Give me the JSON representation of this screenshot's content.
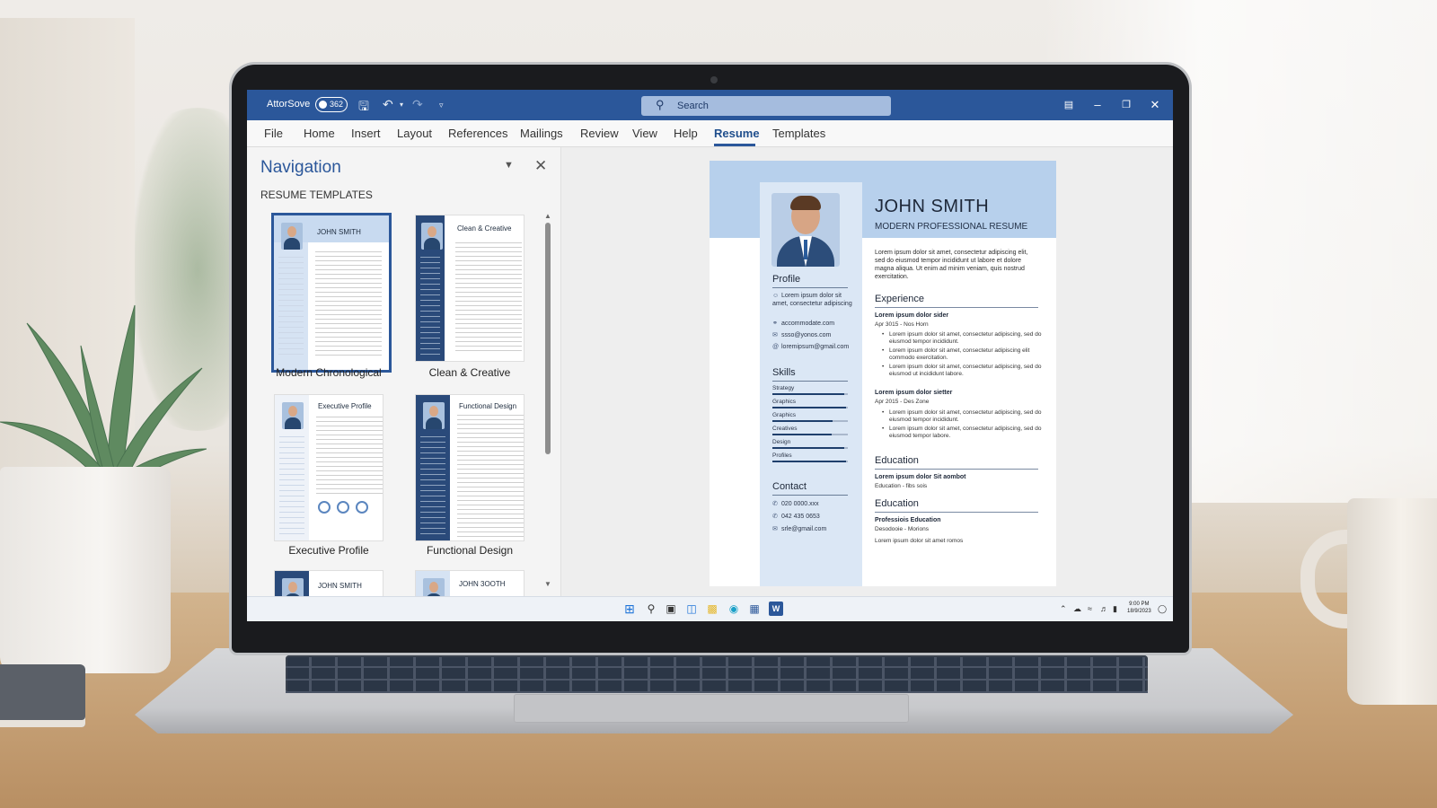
{
  "titlebar": {
    "autosave_label": "AttorSove",
    "autosave_state": "362",
    "search_placeholder": "Search",
    "icons": [
      "save-icon",
      "undo-icon",
      "redo-icon",
      "customize-icon",
      "ribbon-display-icon",
      "minimize-icon",
      "restore-icon",
      "close-icon"
    ],
    "accent_color": "#2b579a"
  },
  "ribbon": {
    "tabs": [
      "File",
      "Home",
      "Insert",
      "Layout",
      "References",
      "Mailings",
      "Review",
      "View",
      "Help",
      "Resume",
      "Templates"
    ],
    "active_tab": "Resume"
  },
  "navigation": {
    "title": "Navigation",
    "section_label": "RESUME TEMPLATES",
    "templates": [
      {
        "label": "Modern Chronological",
        "card_title": "JOHN SMITH",
        "selected": true
      },
      {
        "label": "Clean & Creative",
        "card_title": "Clean & Creative",
        "selected": false
      },
      {
        "label": "Executive Profile",
        "card_title": "Executive Profile",
        "selected": false
      },
      {
        "label": "Functional Design",
        "card_title": "Functional Design",
        "selected": false
      },
      {
        "label": "",
        "card_title": "JOHN SMITH",
        "selected": false
      },
      {
        "label": "",
        "card_title": "JOHN 3OOTH",
        "selected": false
      }
    ]
  },
  "resume": {
    "name": "JOHN SMITH",
    "subtitle": "MODERN PROFESSIONAL RESUME",
    "summary": "Lorem ipsum dolor sit amet, consectetur adipiscing elit, sed do eiusmod tempor incididunt ut labore et dolore magna aliqua. Ut enim ad minim veniam, quis nostrud exercitation.",
    "profile": {
      "heading": "Profile",
      "items": [
        "Lorem ipsum dolor sit amet, consectetur adipiscing",
        "accommodate.com",
        "ssso@yonos.com",
        "loremipsum@gmail.com"
      ]
    },
    "skills": {
      "heading": "Skills",
      "items": [
        {
          "label": "Strategy",
          "level": 0.95
        },
        {
          "label": "Graphics",
          "level": 0.98
        },
        {
          "label": "Graphics",
          "level": 0.8
        },
        {
          "label": "Creatives",
          "level": 0.78
        },
        {
          "label": "Design",
          "level": 0.95
        },
        {
          "label": "Profiles",
          "level": 0.98
        }
      ]
    },
    "contact": {
      "heading": "Contact",
      "items": [
        "020 0000.xxx",
        "042 435 0653",
        "srle@gmail.com"
      ]
    },
    "experience": {
      "heading": "Experience",
      "jobs": [
        {
          "title": "Lorem ipsum dolor sider",
          "dates": "Apr 3015 - Nos Horn",
          "bullets": [
            "Lorem ipsum dolor sit amet, consectetur adipiscing, sed do eiusmod tempor incididunt.",
            "Lorem ipsum dolor sit amet, consectetur adipiscing elit commodo exercitation.",
            "Lorem ipsum dolor sit amet, consectetur adipiscing, sed do eiusmod ut incididunt labore."
          ]
        },
        {
          "title": "Lorem ipsum dolor sietter",
          "dates": "Apr 2015 - Des Zone",
          "bullets": [
            "Lorem ipsum dolor sit amet, consectetur adipiscing, sed do eiusmod tempor incididunt.",
            "Lorem ipsum dolor sit amet, consectetur adipiscing, sed do eiusmod tempor labore."
          ]
        }
      ]
    },
    "education_1": {
      "heading": "Education",
      "title": "Lorem ipsum dolor Sit aombot",
      "detail": "Education - fibs sois"
    },
    "education_2": {
      "heading": "Education",
      "title": "Professiois Education",
      "detail": "Desodooie - Morions",
      "extra": "Lorem ipsum dolor sit amet romos"
    }
  },
  "taskbar": {
    "icons": [
      "windows-start-icon",
      "search-icon",
      "task-view-icon",
      "widgets-icon",
      "file-explorer-icon",
      "edge-icon",
      "store-icon",
      "word-icon"
    ],
    "time": "9:00 PM",
    "date": "18/9/2023"
  }
}
